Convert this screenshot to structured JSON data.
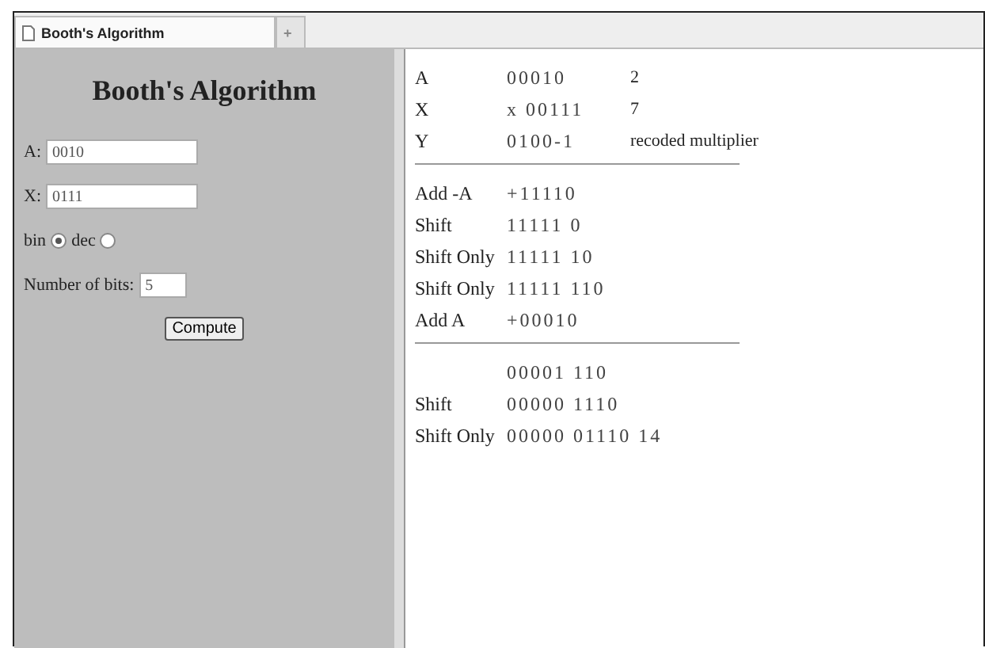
{
  "tabs": [
    {
      "title": "Booth's Algorithm",
      "selected": true
    },
    {
      "title": "+",
      "selected": false
    }
  ],
  "form": {
    "heading": "Booth's Algorithm",
    "fields": [
      {
        "label": "A:",
        "value": "0010"
      },
      {
        "label": "X:",
        "value": "0111"
      }
    ],
    "radios": [
      {
        "label": "bin",
        "selected": true
      },
      {
        "label": "dec",
        "selected": false
      }
    ],
    "bits": {
      "label": "Number of bits:",
      "value": "5"
    },
    "button": "Compute"
  },
  "result": {
    "groups": [
      [
        {
          "label": "A",
          "value": "00010",
          "note": "2"
        },
        {
          "label": "X",
          "value": "x 00111",
          "note": "7"
        },
        {
          "label": "Y",
          "value": "0100-1",
          "note": "recoded multiplier"
        }
      ],
      [
        {
          "label": "Add -A",
          "value": "+11110"
        },
        {
          "label": "Shift",
          "value": "11111 0"
        },
        {
          "label": "Shift Only",
          "value": "11111 10"
        },
        {
          "label": "Shift Only",
          "value": "11111 110"
        },
        {
          "label": "Add A",
          "value": "+00010"
        }
      ],
      [
        {
          "value": "00001 110"
        },
        {
          "label": "Shift",
          "value": "00000 1110"
        },
        {
          "label": "Shift Only",
          "value": "00000 01110 14"
        }
      ]
    ]
  }
}
